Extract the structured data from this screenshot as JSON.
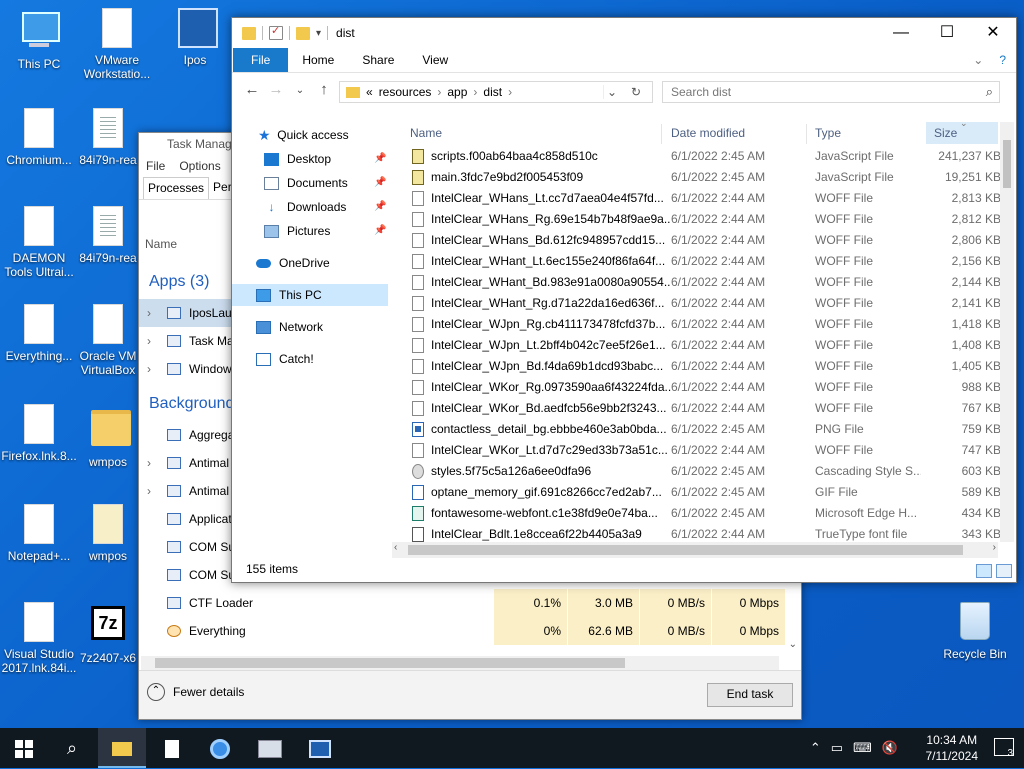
{
  "desktop": {
    "icons": [
      {
        "label": "This PC"
      },
      {
        "label": "VMware Workstatio..."
      },
      {
        "label": "Ipos"
      },
      {
        "label": "Chromium..."
      },
      {
        "label": "84i79n-rea"
      },
      {
        "label": "DAEMON Tools Ultrai..."
      },
      {
        "label": "84i79n-rea"
      },
      {
        "label": "Everything..."
      },
      {
        "label": "Oracle VM VirtualBox"
      },
      {
        "label": "Firefox.lnk.8..."
      },
      {
        "label": "wmpos"
      },
      {
        "label": "Notepad+..."
      },
      {
        "label": "wmpos"
      },
      {
        "label": "Visual Studio 2017.lnk.84i..."
      },
      {
        "label": "7z2407-x6"
      },
      {
        "label": "Recycle Bin"
      }
    ]
  },
  "task_manager": {
    "title": "Task Manag",
    "menu": [
      "File",
      "Options"
    ],
    "tabs": [
      "Processes",
      "Perf"
    ],
    "col_name": "Name",
    "groups": {
      "apps": "Apps (3)",
      "background": "Background"
    },
    "app_rows": [
      "IposLau",
      "Task Ma",
      "Window"
    ],
    "bg_rows": [
      "Aggrega",
      "Antimal",
      "Antimal",
      "Applicat",
      "COM Su",
      "COM Su",
      "CTF Loader",
      "Everything"
    ],
    "ctf_values": {
      "cpu": "0.1%",
      "mem": "3.0 MB",
      "disk": "0 MB/s",
      "net": "0 Mbps"
    },
    "everything_values": {
      "cpu": "0%",
      "mem": "62.6 MB",
      "disk": "0 MB/s",
      "net": "0 Mbps"
    },
    "fewer_details": "Fewer details",
    "end_task": "End task"
  },
  "explorer": {
    "title": "dist",
    "ribbon_tabs": [
      "File",
      "Home",
      "Share",
      "View"
    ],
    "breadcrumb": [
      "resources",
      "app",
      "dist"
    ],
    "breadcrumb_prefix": "«",
    "search_placeholder": "Search dist",
    "nav": {
      "quick_access": "Quick access",
      "desktop": "Desktop",
      "documents": "Documents",
      "downloads": "Downloads",
      "pictures": "Pictures",
      "onedrive": "OneDrive",
      "this_pc": "This PC",
      "network": "Network",
      "catch": "Catch!"
    },
    "columns": {
      "name": "Name",
      "date": "Date modified",
      "type": "Type",
      "size": "Size"
    },
    "files": [
      {
        "name": "scripts.f00ab64baa4c858d510c",
        "date": "6/1/2022 2:45 AM",
        "type": "JavaScript File",
        "size": "241,237 KB",
        "kind": "js"
      },
      {
        "name": "main.3fdc7e9bd2f005453f09",
        "date": "6/1/2022 2:45 AM",
        "type": "JavaScript File",
        "size": "19,251 KB",
        "kind": "js"
      },
      {
        "name": "IntelClear_WHans_Lt.cc7d7aea04e4f57fd...",
        "date": "6/1/2022 2:44 AM",
        "type": "WOFF File",
        "size": "2,813 KB",
        "kind": "woff"
      },
      {
        "name": "IntelClear_WHans_Rg.69e154b7b48f9ae9a...",
        "date": "6/1/2022 2:44 AM",
        "type": "WOFF File",
        "size": "2,812 KB",
        "kind": "woff"
      },
      {
        "name": "IntelClear_WHans_Bd.612fc948957cdd15...",
        "date": "6/1/2022 2:44 AM",
        "type": "WOFF File",
        "size": "2,806 KB",
        "kind": "woff"
      },
      {
        "name": "IntelClear_WHant_Lt.6ec155e240f86fa64f...",
        "date": "6/1/2022 2:44 AM",
        "type": "WOFF File",
        "size": "2,156 KB",
        "kind": "woff"
      },
      {
        "name": "IntelClear_WHant_Bd.983e91a0080a90554...",
        "date": "6/1/2022 2:44 AM",
        "type": "WOFF File",
        "size": "2,144 KB",
        "kind": "woff"
      },
      {
        "name": "IntelClear_WHant_Rg.d71a22da16ed636f...",
        "date": "6/1/2022 2:44 AM",
        "type": "WOFF File",
        "size": "2,141 KB",
        "kind": "woff"
      },
      {
        "name": "IntelClear_WJpn_Rg.cb411173478fcfd37b...",
        "date": "6/1/2022 2:44 AM",
        "type": "WOFF File",
        "size": "1,418 KB",
        "kind": "woff"
      },
      {
        "name": "IntelClear_WJpn_Lt.2bff4b042c7ee5f26e1...",
        "date": "6/1/2022 2:44 AM",
        "type": "WOFF File",
        "size": "1,408 KB",
        "kind": "woff"
      },
      {
        "name": "IntelClear_WJpn_Bd.f4da69b1dcd93babc...",
        "date": "6/1/2022 2:44 AM",
        "type": "WOFF File",
        "size": "1,405 KB",
        "kind": "woff"
      },
      {
        "name": "IntelClear_WKor_Rg.0973590aa6f43224fda...",
        "date": "6/1/2022 2:44 AM",
        "type": "WOFF File",
        "size": "988 KB",
        "kind": "woff"
      },
      {
        "name": "IntelClear_WKor_Bd.aedfcb56e9bb2f3243...",
        "date": "6/1/2022 2:44 AM",
        "type": "WOFF File",
        "size": "767 KB",
        "kind": "woff"
      },
      {
        "name": "contactless_detail_bg.ebbbe460e3ab0bda...",
        "date": "6/1/2022 2:45 AM",
        "type": "PNG File",
        "size": "759 KB",
        "kind": "png"
      },
      {
        "name": "IntelClear_WKor_Lt.d7d7c29ed33b73a51c...",
        "date": "6/1/2022 2:44 AM",
        "type": "WOFF File",
        "size": "747 KB",
        "kind": "woff"
      },
      {
        "name": "styles.5f75c5a126a6ee0dfa96",
        "date": "6/1/2022 2:45 AM",
        "type": "Cascading Style S...",
        "size": "603 KB",
        "kind": "css"
      },
      {
        "name": "optane_memory_gif.691c8266cc7ed2ab7...",
        "date": "6/1/2022 2:45 AM",
        "type": "GIF File",
        "size": "589 KB",
        "kind": "gif"
      },
      {
        "name": "fontawesome-webfont.c1e38fd9e0e74ba...",
        "date": "6/1/2022 2:45 AM",
        "type": "Microsoft Edge H...",
        "size": "434 KB",
        "kind": "edge"
      },
      {
        "name": "IntelClear_Bdlt.1e8ccea6f22b4405a3a9",
        "date": "6/1/2022 2:44 AM",
        "type": "TrueType font file",
        "size": "343 KB",
        "kind": "ttf"
      }
    ],
    "status": "155 items"
  },
  "taskbar": {
    "time": "10:34 AM",
    "date": "7/11/2024",
    "notifications": "3"
  }
}
